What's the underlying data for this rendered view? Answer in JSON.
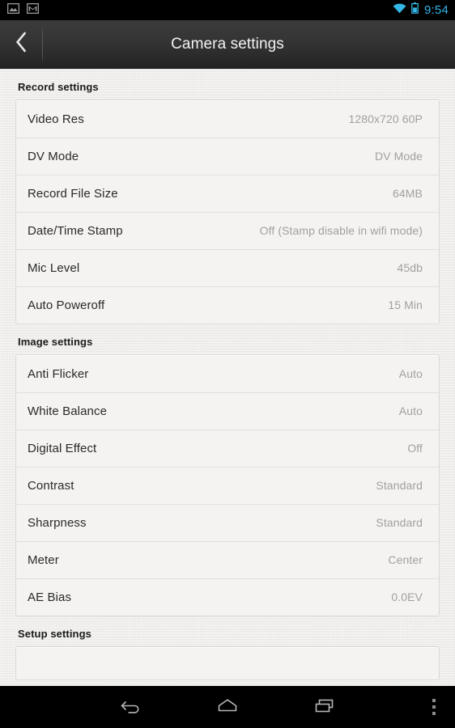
{
  "statusbar": {
    "left_icons": [
      "gallery-icon",
      "gmail-icon"
    ],
    "right_icons": [
      "wifi-icon",
      "battery-icon"
    ],
    "time": "9:54",
    "accent_color": "#33b5e5"
  },
  "actionbar": {
    "back_icon": "back-chevron-icon",
    "title": "Camera settings"
  },
  "sections": [
    {
      "header": "Record settings",
      "rows": [
        {
          "label": "Video Res",
          "value": "1280x720 60P"
        },
        {
          "label": "DV Mode",
          "value": "DV Mode"
        },
        {
          "label": "Record File Size",
          "value": "64MB"
        },
        {
          "label": "Date/Time Stamp",
          "value": "Off (Stamp disable in wifi mode)"
        },
        {
          "label": "Mic Level",
          "value": "45db"
        },
        {
          "label": "Auto Poweroff",
          "value": "15 Min"
        }
      ]
    },
    {
      "header": "Image settings",
      "rows": [
        {
          "label": "Anti Flicker",
          "value": "Auto"
        },
        {
          "label": "White Balance",
          "value": "Auto"
        },
        {
          "label": "Digital Effect",
          "value": "Off"
        },
        {
          "label": "Contrast",
          "value": "Standard"
        },
        {
          "label": "Sharpness",
          "value": "Standard"
        },
        {
          "label": "Meter",
          "value": "Center"
        },
        {
          "label": "AE Bias",
          "value": "0.0EV"
        }
      ]
    },
    {
      "header": "Setup settings",
      "rows": []
    }
  ],
  "navbar": {
    "back": "back-icon",
    "home": "home-icon",
    "recents": "recents-icon",
    "menu": "overflow-menu-icon"
  }
}
